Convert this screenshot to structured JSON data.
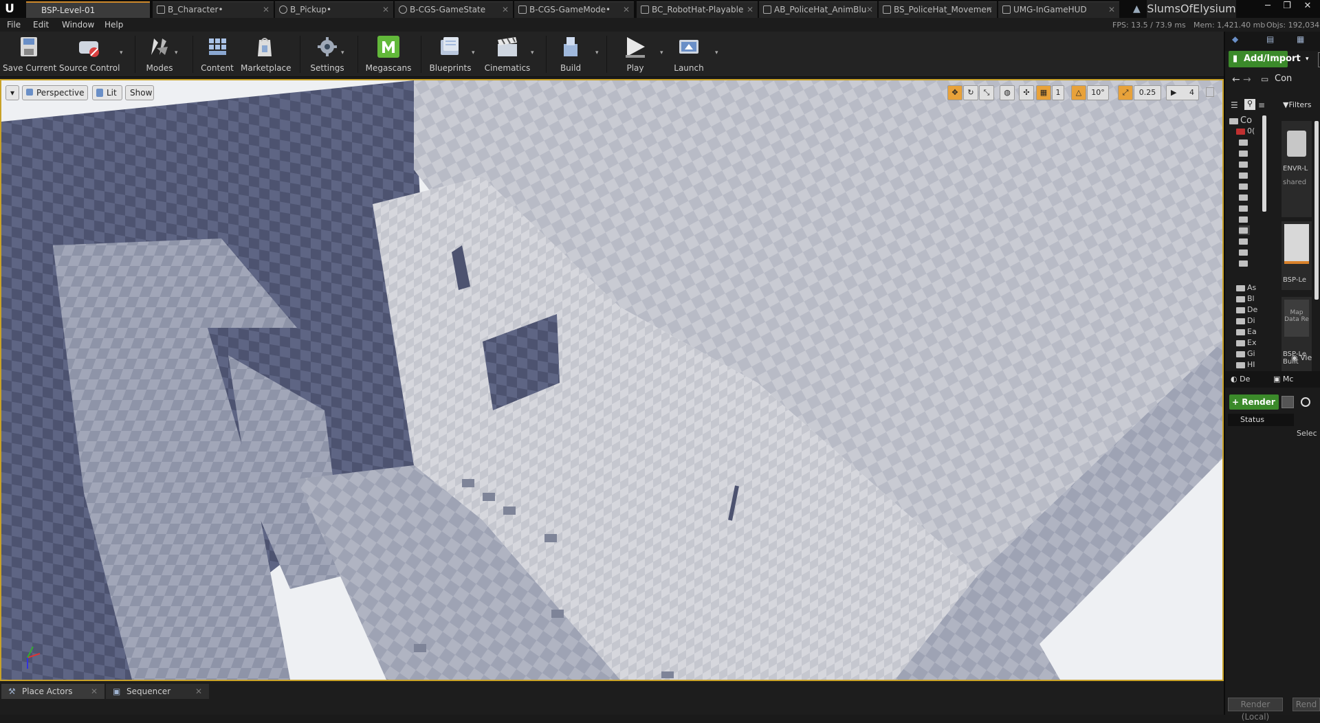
{
  "tabs": [
    {
      "label": "BSP-Level-01",
      "active": true
    },
    {
      "label": "B_Character•"
    },
    {
      "label": "B_Pickup•"
    },
    {
      "label": "B-CGS-GameState"
    },
    {
      "label": "B-CGS-GameMode•"
    },
    {
      "label": "BC_RobotHat-Playable"
    },
    {
      "label": "AB_PoliceHat_AnimBlu"
    },
    {
      "label": "BS_PoliceHat_Movemen"
    },
    {
      "label": "UMG-InGameHUD"
    }
  ],
  "project_name": "SlumsOfElysium",
  "window_controls": {
    "minimize": "─",
    "restore": "❐",
    "close": "✕"
  },
  "menu": [
    "File",
    "Edit",
    "Window",
    "Help"
  ],
  "stats": {
    "fps": "FPS: 13.5 / 73.9 ms",
    "mem": "Mem: 1,421.40 mb",
    "objs": "Objs: 192,034"
  },
  "toolbar": [
    {
      "label": "Save Current",
      "icon": "save-icon"
    },
    {
      "label": "Source Control",
      "icon": "source-control-icon"
    },
    {
      "label": "Modes",
      "icon": "modes-icon"
    },
    {
      "label": "Content",
      "icon": "content-icon"
    },
    {
      "label": "Marketplace",
      "icon": "marketplace-icon"
    },
    {
      "label": "Settings",
      "icon": "settings-icon"
    },
    {
      "label": "Megascans",
      "icon": "megascans-icon"
    },
    {
      "label": "Blueprints",
      "icon": "blueprints-icon"
    },
    {
      "label": "Cinematics",
      "icon": "cinematics-icon"
    },
    {
      "label": "Build",
      "icon": "build-icon"
    },
    {
      "label": "Play",
      "icon": "play-icon"
    },
    {
      "label": "Launch",
      "icon": "launch-icon"
    }
  ],
  "viewport": {
    "view_mode": "Perspective",
    "lighting": "Lit",
    "show": "Show",
    "camera_speed": "1",
    "rotation_snap": "10°",
    "scale_snap": "0.25",
    "camera_speed_value": "4"
  },
  "content_browser": {
    "add_import": "Add/Import",
    "path": "Con",
    "filters": "Filters",
    "tree_root": "Co",
    "tree_sub": "0(",
    "tree_items": [
      "As",
      "Bl",
      "De",
      "Di",
      "Ea",
      "Ex",
      "Gi",
      "HI"
    ],
    "assets": [
      {
        "name": "ENVR-L",
        "sub": "shared"
      },
      {
        "name": "BSP-Le"
      },
      {
        "name": "Map Data Re",
        "sub": "BSP-Le Built"
      }
    ],
    "view_options": "Vie"
  },
  "details": {
    "tab1": "De",
    "tab2": "Mc",
    "render_button": "Render",
    "status_label": "Status",
    "selected_label": "Selec",
    "render_local": "Render (Local)",
    "render_right": "Rend"
  },
  "bottom_tabs": [
    "Place Actors",
    "Sequencer"
  ],
  "colors": {
    "accent": "#c9a227",
    "green": "#3b8a2a",
    "orange": "#e8a23a"
  }
}
